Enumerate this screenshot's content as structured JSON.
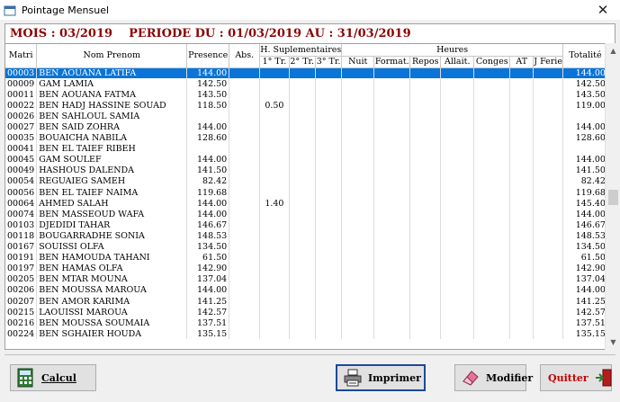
{
  "window": {
    "title": "Pointage Mensuel",
    "close_glyph": "✕"
  },
  "header": {
    "month_label": "MOIS : 03/2019",
    "period_label": "PERIODE DU : 01/03/2019 AU : 31/03/2019"
  },
  "columns": {
    "group_hsup": "H. Suplementaires",
    "group_heures": "Heures",
    "matri": "Matri",
    "nom_prenom": "Nom Prenom",
    "presence": "Presence",
    "abs": "Abs.",
    "tr1": "1° Tr.",
    "tr2": "2° Tr.",
    "tr3": "3° Tr.",
    "nuit": "Nuit",
    "format": "Format.",
    "repos": "Repos",
    "allait": "Allait.",
    "conges": "Conges",
    "at": "AT",
    "jferie": "J Ferie",
    "totalite": "Totalité"
  },
  "rows": [
    {
      "matri": "00003",
      "nom": "BEN AOUANA LATIFA",
      "presence": "144.00",
      "tr1": "",
      "total": "144.00",
      "selected": true
    },
    {
      "matri": "00009",
      "nom": "GAM LAMIA",
      "presence": "142.50",
      "tr1": "",
      "total": "142.50"
    },
    {
      "matri": "00011",
      "nom": "BEN AOUANA FATMA",
      "presence": "143.50",
      "tr1": "",
      "total": "143.50"
    },
    {
      "matri": "00022",
      "nom": "BEN HADJ HASSINE SOUAD",
      "presence": "118.50",
      "tr1": "0.50",
      "total": "119.00"
    },
    {
      "matri": "00026",
      "nom": "BEN SAHLOUL SAMIA",
      "presence": "",
      "tr1": "",
      "total": ""
    },
    {
      "matri": "00027",
      "nom": "BEN SAID ZOHRA",
      "presence": "144.00",
      "tr1": "",
      "total": "144.00"
    },
    {
      "matri": "00035",
      "nom": "BOUAICHA NABILA",
      "presence": "128.60",
      "tr1": "",
      "total": "128.60"
    },
    {
      "matri": "00041",
      "nom": "BEN EL TAIEF RIBEH",
      "presence": "",
      "tr1": "",
      "total": ""
    },
    {
      "matri": "00045",
      "nom": "GAM SOULEF",
      "presence": "144.00",
      "tr1": "",
      "total": "144.00"
    },
    {
      "matri": "00049",
      "nom": "HASHOUS DALENDA",
      "presence": "141.50",
      "tr1": "",
      "total": "141.50"
    },
    {
      "matri": "00054",
      "nom": "REGUAIEG SAMEH",
      "presence": "82.42",
      "tr1": "",
      "total": "82.42"
    },
    {
      "matri": "00056",
      "nom": "BEN EL TAIEF NAIMA",
      "presence": "119.68",
      "tr1": "",
      "total": "119.68"
    },
    {
      "matri": "00064",
      "nom": "AHMED SALAH",
      "presence": "144.00",
      "tr1": "1.40",
      "total": "145.40"
    },
    {
      "matri": "00074",
      "nom": "BEN MASSEOUD WAFA",
      "presence": "144.00",
      "tr1": "",
      "total": "144.00"
    },
    {
      "matri": "00103",
      "nom": "DJEDIDI TAHAR",
      "presence": "146.67",
      "tr1": "",
      "total": "146.67"
    },
    {
      "matri": "00118",
      "nom": "BOUGARRADHE SONIA",
      "presence": "148.53",
      "tr1": "",
      "total": "148.53"
    },
    {
      "matri": "00167",
      "nom": "SOUISSI OLFA",
      "presence": "134.50",
      "tr1": "",
      "total": "134.50"
    },
    {
      "matri": "00191",
      "nom": "BEN HAMOUDA TAHANI",
      "presence": "61.50",
      "tr1": "",
      "total": "61.50"
    },
    {
      "matri": "00197",
      "nom": "BEN HAMAS OLFA",
      "presence": "142.90",
      "tr1": "",
      "total": "142.90"
    },
    {
      "matri": "00205",
      "nom": "BEN MTAR MOUNA",
      "presence": "137.04",
      "tr1": "",
      "total": "137.04"
    },
    {
      "matri": "00206",
      "nom": "BEN MOUSSA MAROUA",
      "presence": "144.00",
      "tr1": "",
      "total": "144.00"
    },
    {
      "matri": "00207",
      "nom": "BEN AMOR KARIMA",
      "presence": "141.25",
      "tr1": "",
      "total": "141.25"
    },
    {
      "matri": "00215",
      "nom": "LAOUISSI MAROUA",
      "presence": "142.57",
      "tr1": "",
      "total": "142.57"
    },
    {
      "matri": "00216",
      "nom": "BEN MOUSSA SOUMAIA",
      "presence": "137.51",
      "tr1": "",
      "total": "137.51"
    },
    {
      "matri": "00224",
      "nom": "BEN SGHAIER HOUDA",
      "presence": "135.15",
      "tr1": "",
      "total": "135.15"
    }
  ],
  "buttons": {
    "calcul": "Calcul",
    "imprimer": "Imprimer",
    "modifier": "Modifier",
    "quitter": "Quitter"
  },
  "colors": {
    "selection": "#0a74d9",
    "header_text": "#8b0000",
    "quit_text": "#c00000"
  }
}
